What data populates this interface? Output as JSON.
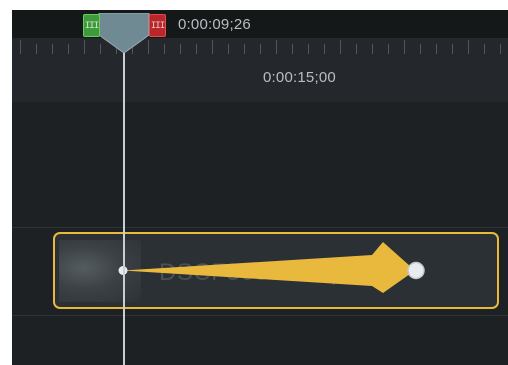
{
  "timeline": {
    "playhead_time": "0:00:09;26",
    "ruler_marker_time": "0:00:15;00"
  },
  "handles": {
    "in_glyph": "III",
    "out_glyph": "III"
  },
  "clip": {
    "name": "DSCF3637 - copie"
  },
  "colors": {
    "clip_border": "#e8b93d",
    "motion_path": "#e8b93d",
    "in_handle": "#3f9a3c",
    "out_handle": "#b9272a",
    "playhead": "#6f8a93"
  }
}
